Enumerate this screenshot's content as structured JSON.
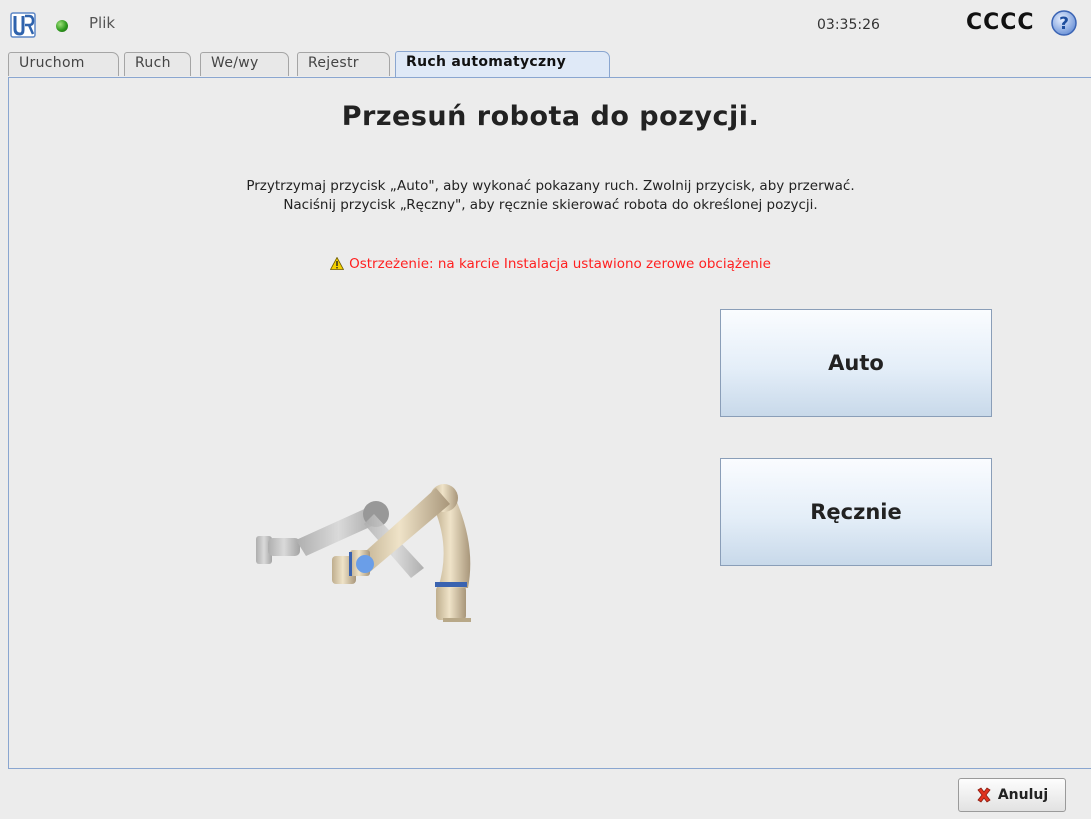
{
  "header": {
    "file_menu": "Plik",
    "clock": "03:35:26",
    "robot_name": "CCCC",
    "status_color": "#2f9a1e",
    "logo_icon": "universal-robots-logo",
    "help_icon": "help-icon"
  },
  "tabs": [
    {
      "label": "Uruchom"
    },
    {
      "label": "Ruch"
    },
    {
      "label": "We/wy"
    },
    {
      "label": "Rejestr"
    },
    {
      "label": "Ruch automatyczny",
      "active": true
    }
  ],
  "main": {
    "title": "Przesuń robota do pozycji.",
    "instruction_line1": "Przytrzymaj przycisk „Auto\", aby wykonać pokazany ruch. Zwolnij przycisk, aby przerwać.",
    "instruction_line2": "Naciśnij przycisk „Ręczny\", aby ręcznie skierować robota do określonej pozycji.",
    "warning": "Ostrzeżenie: na karcie Instalacja ustawiono zerowe obciążenie",
    "warning_color": "#ff2020",
    "auto_button": "Auto",
    "manual_button": "Ręcznie"
  },
  "footer": {
    "cancel_button": "Anuluj"
  }
}
